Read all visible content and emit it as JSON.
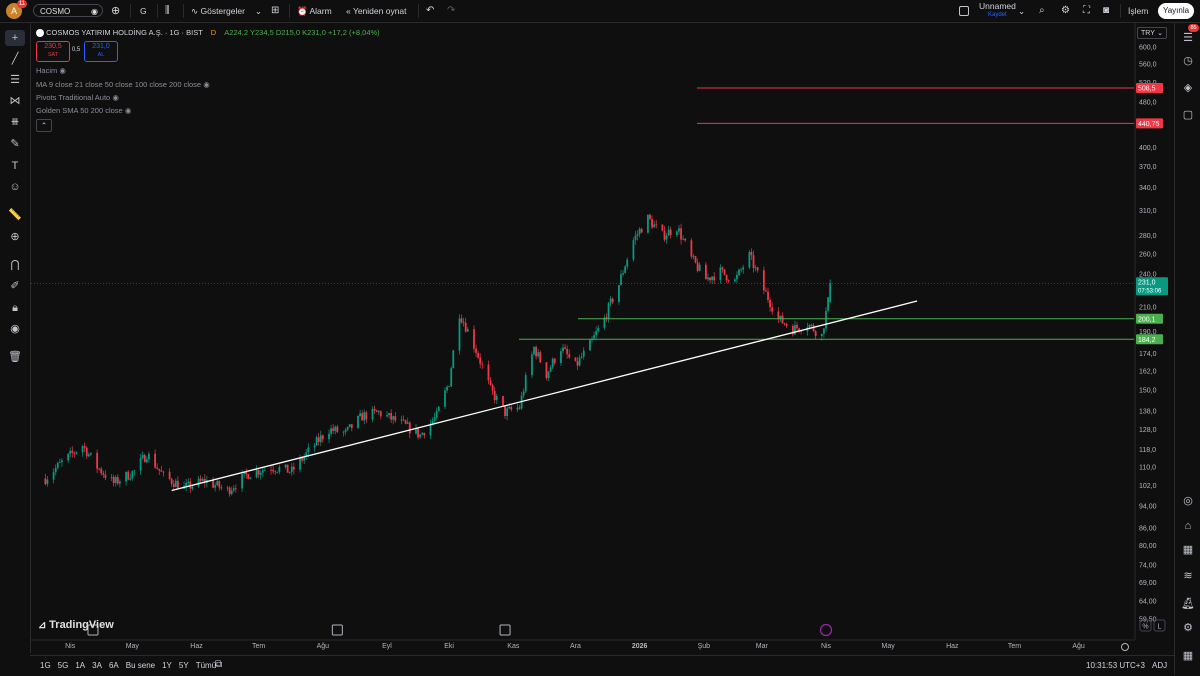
{
  "topbar": {
    "avatar": "A",
    "notifications": "11",
    "symbol": "COSMO",
    "interval": "G",
    "indicators": "Göstergeler",
    "alarm": "Alarm",
    "replay": "Yeniden oynat",
    "layout_name": "Unnamed",
    "layout_status": "Kaydet",
    "trade": "İşlem",
    "publish": "Yayınla"
  },
  "legend": {
    "title": "COSMOS YATIRIM HOLDİNG A.Ş. · 1G · BIST",
    "d_badge": "D",
    "ohlc": "A224,2  Y234,5  D215,0  K231,0  +17,2 (+8,04%)",
    "sell_price": "230,5",
    "sell_label": "SAT",
    "spread": "0,5",
    "buy_price": "231,0",
    "buy_label": "AL",
    "indicators": [
      "Hacim",
      "MA 9 close 21 close 50 close 100 close 200 close",
      "Pivots Traditional Auto",
      "Golden SMA 50 200 close"
    ]
  },
  "currency": "TRY",
  "right_panel_badge": "85",
  "chart_data": {
    "type": "candlestick",
    "symbol": "COSMO",
    "exchange": "BIST",
    "interval": "1G",
    "price_axis_ticks": [
      "600,0",
      "560,0",
      "520,0",
      "480,0",
      "440,0",
      "400,0",
      "370,0",
      "340,0",
      "310,0",
      "280,0",
      "260,0",
      "240,0",
      "210,0",
      "190,0",
      "174,0",
      "162,0",
      "150,0",
      "138,0",
      "128,0",
      "118,0",
      "110,0",
      "102,0",
      "94,00",
      "86,00",
      "80,00",
      "74,00",
      "69,00",
      "64,00",
      "59,50"
    ],
    "time_axis_ticks": [
      "Nis",
      "May",
      "Haz",
      "Tem",
      "Ağu",
      "Eyl",
      "Eki",
      "Kas",
      "Ara",
      "2026",
      "Şub",
      "Mar",
      "Nis",
      "May",
      "Haz",
      "Tem",
      "Ağu"
    ],
    "last_price": "231,0",
    "countdown": "07:53:06",
    "horizontal_lines": [
      {
        "price": 508.5,
        "label": "508,5",
        "color": "#f23645"
      },
      {
        "price": 440.75,
        "label": "440,75",
        "color": "#f23645"
      },
      {
        "price": 200.1,
        "label": "200,1",
        "color": "#4caf50"
      },
      {
        "price": 184.2,
        "label": "184,2",
        "color": "#4caf50"
      }
    ],
    "trendline": {
      "from": {
        "date": "2025-05-20",
        "price": 100
      },
      "to": {
        "date": "2026-05-15",
        "price": 215
      },
      "color": "#ffffff"
    },
    "ylim": [
      59.5,
      600
    ],
    "log_scale": true,
    "scale_buttons": [
      "%",
      "L"
    ],
    "watermark": "TradingView",
    "bull_color": "#089981",
    "bear_color": "#f23645",
    "price_path": [
      [
        "2025-03-20",
        105
      ],
      [
        "2025-03-28",
        112
      ],
      [
        "2025-04-07",
        120
      ],
      [
        "2025-04-14",
        110
      ],
      [
        "2025-04-22",
        103
      ],
      [
        "2025-05-02",
        108
      ],
      [
        "2025-05-08",
        116
      ],
      [
        "2025-05-16",
        106
      ],
      [
        "2025-05-26",
        101
      ],
      [
        "2025-06-05",
        104
      ],
      [
        "2025-06-16",
        100
      ],
      [
        "2025-06-26",
        107
      ],
      [
        "2025-07-07",
        110
      ],
      [
        "2025-07-17",
        108
      ],
      [
        "2025-07-25",
        117
      ],
      [
        "2025-08-04",
        128
      ],
      [
        "2025-08-12",
        126
      ],
      [
        "2025-08-20",
        135
      ],
      [
        "2025-08-28",
        137
      ],
      [
        "2025-09-08",
        131
      ],
      [
        "2025-09-17",
        125
      ],
      [
        "2025-09-25",
        135
      ],
      [
        "2025-10-01",
        155
      ],
      [
        "2025-10-06",
        205
      ],
      [
        "2025-10-13",
        180
      ],
      [
        "2025-10-21",
        150
      ],
      [
        "2025-10-28",
        137
      ],
      [
        "2025-11-04",
        140
      ],
      [
        "2025-11-11",
        178
      ],
      [
        "2025-11-17",
        160
      ],
      [
        "2025-11-24",
        178
      ],
      [
        "2025-12-01",
        165
      ],
      [
        "2025-12-08",
        180
      ],
      [
        "2025-12-15",
        200
      ],
      [
        "2025-12-22",
        230
      ],
      [
        "2025-12-29",
        275
      ],
      [
        "2026-01-05",
        300
      ],
      [
        "2026-01-12",
        280
      ],
      [
        "2026-01-19",
        290
      ],
      [
        "2026-01-26",
        255
      ],
      [
        "2026-02-02",
        235
      ],
      [
        "2026-02-09",
        242
      ],
      [
        "2026-02-16",
        233
      ],
      [
        "2026-02-23",
        258
      ],
      [
        "2026-03-02",
        225
      ],
      [
        "2026-03-09",
        200
      ],
      [
        "2026-03-16",
        192
      ],
      [
        "2026-03-23",
        196
      ],
      [
        "2026-03-30",
        187
      ],
      [
        "2026-04-02",
        214
      ],
      [
        "2026-04-03",
        231
      ]
    ]
  },
  "bottombar": {
    "ranges": [
      "1G",
      "5G",
      "1A",
      "3A",
      "6A",
      "Bu sene",
      "1Y",
      "5Y",
      "Tümü"
    ],
    "time": "10:31:53 UTC+3",
    "adj": "ADJ"
  }
}
